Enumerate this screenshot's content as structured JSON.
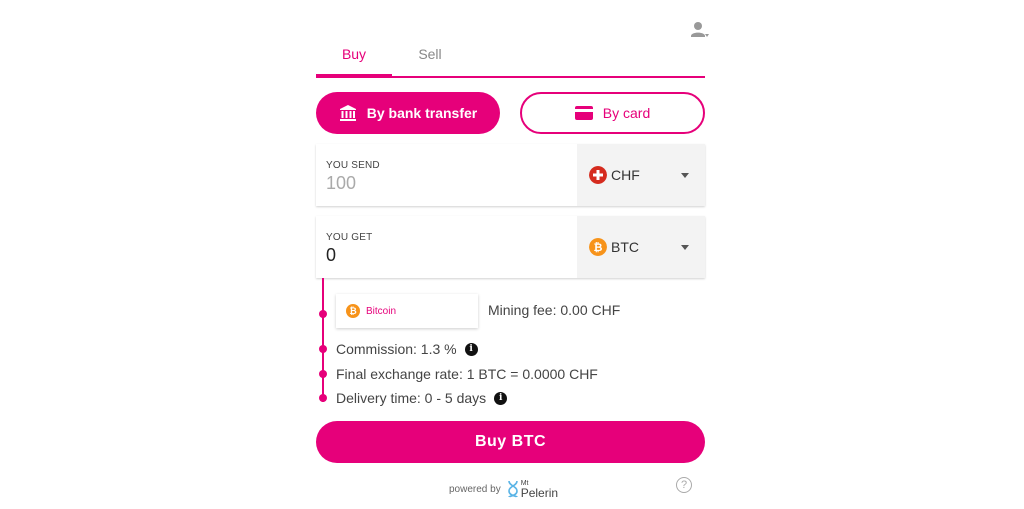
{
  "tabs": [
    {
      "label": "Buy",
      "active": true
    },
    {
      "label": "Sell",
      "active": false
    }
  ],
  "payment_methods": {
    "bank": {
      "label": "By bank transfer",
      "icon": "bank-icon",
      "selected": true
    },
    "card": {
      "label": "By card",
      "icon": "credit-card-icon",
      "selected": false
    }
  },
  "send": {
    "label": "YOU SEND",
    "placeholder": "100",
    "currency": "CHF",
    "flag_icon": "swiss-flag-icon"
  },
  "get": {
    "label": "YOU GET",
    "value": "0",
    "currency": "BTC",
    "flag_icon": "bitcoin-icon"
  },
  "details": {
    "network": "Bitcoin",
    "mining_fee": "Mining fee: 0.00 CHF",
    "commission": "Commission: 1.3 %",
    "exchange_rate": "Final exchange rate: 1 BTC = 0.0000 CHF",
    "delivery_time": "Delivery time: 0 - 5 days"
  },
  "buy_button": {
    "label": "Buy BTC"
  },
  "footer": {
    "powered_by": "powered by",
    "brand_small": "Mt",
    "brand_name": "Pelerin",
    "help_symbol": "?"
  },
  "colors": {
    "accent": "#e6007a",
    "bitcoin": "#f7931a",
    "swiss_red": "#d52b1e"
  }
}
